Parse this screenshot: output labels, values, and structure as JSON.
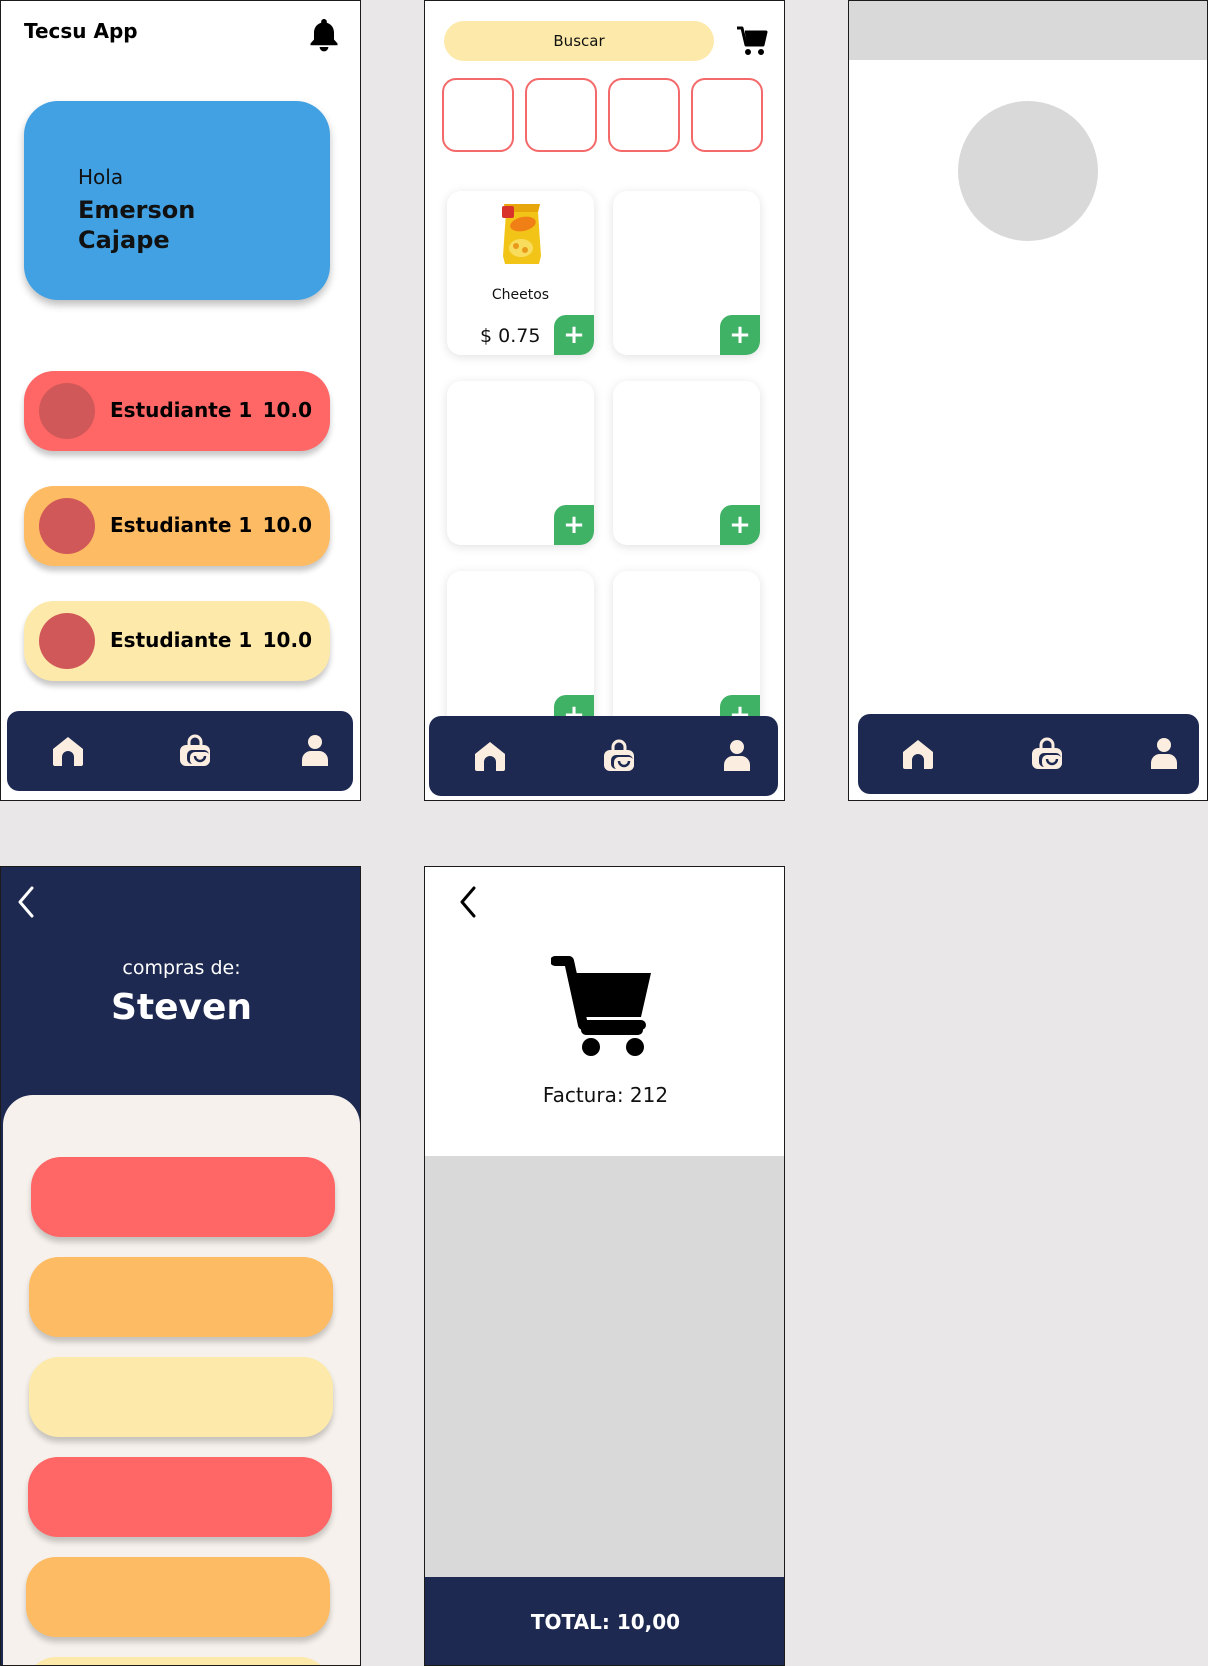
{
  "colors": {
    "navy": "#1d2951",
    "blue_card": "#42a1e3",
    "red": "#ff6666",
    "orange": "#fdbb63",
    "yellow": "#fde9a9",
    "green": "#3fb266",
    "cream": "#f6f1ec",
    "placeholder_gray": "#d9d9d9",
    "nav_icon": "#fbeee0"
  },
  "nav": {
    "items": [
      {
        "icon": "home-icon"
      },
      {
        "icon": "shopping-bag-icon"
      },
      {
        "icon": "user-icon"
      }
    ]
  },
  "home": {
    "app_title": "Tecsu App",
    "greeting": "Hola",
    "user_name": "Emerson Cajape",
    "students": [
      {
        "name": "Estudiante 1",
        "score": "10.0",
        "color": "#ff6666"
      },
      {
        "name": "Estudiante 1",
        "score": "10.0",
        "color": "#fdbb63"
      },
      {
        "name": "Estudiante 1",
        "score": "10.0",
        "color": "#fde9a9"
      }
    ]
  },
  "shop": {
    "search_label": "Buscar",
    "add_label": "+",
    "products": [
      {
        "name": "Cheetos",
        "price": "$ 0.75"
      }
    ]
  },
  "purchases": {
    "subtitle": "compras de:",
    "name": "Steven"
  },
  "invoice": {
    "label": "Factura: 212",
    "total": "TOTAL: 10,00"
  }
}
